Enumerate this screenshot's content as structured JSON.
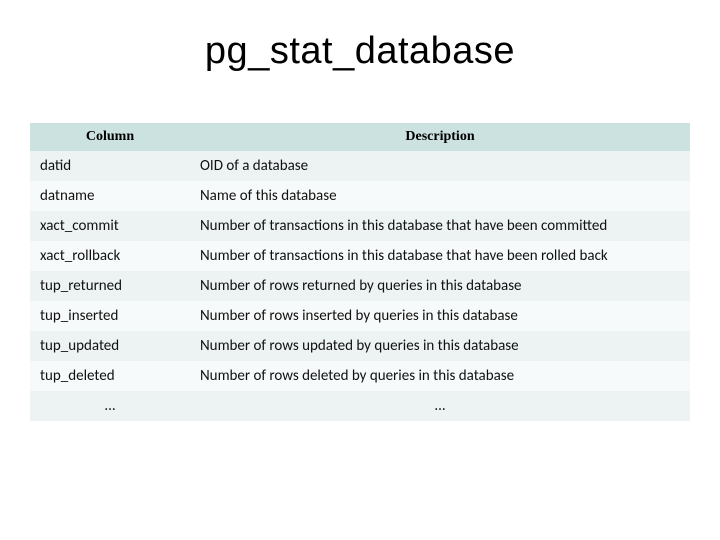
{
  "title": "pg_stat_database",
  "headers": {
    "column": "Column",
    "description": "Description"
  },
  "rows": [
    {
      "column": "datid",
      "description": "OID of a database"
    },
    {
      "column": "datname",
      "description": "Name of this database"
    },
    {
      "column": "xact_commit",
      "description": "Number of transactions in this database that have been committed"
    },
    {
      "column": "xact_rollback",
      "description": "Number of transactions in this database that have been rolled back"
    },
    {
      "column": "tup_returned",
      "description": "Number of rows returned by queries in this database"
    },
    {
      "column": "tup_inserted",
      "description": "Number of rows inserted by queries in this database"
    },
    {
      "column": "tup_updated",
      "description": "Number of rows updated by queries in this database"
    },
    {
      "column": "tup_deleted",
      "description": "Number of rows deleted by queries in this database"
    },
    {
      "column": "...",
      "description": "..."
    }
  ]
}
